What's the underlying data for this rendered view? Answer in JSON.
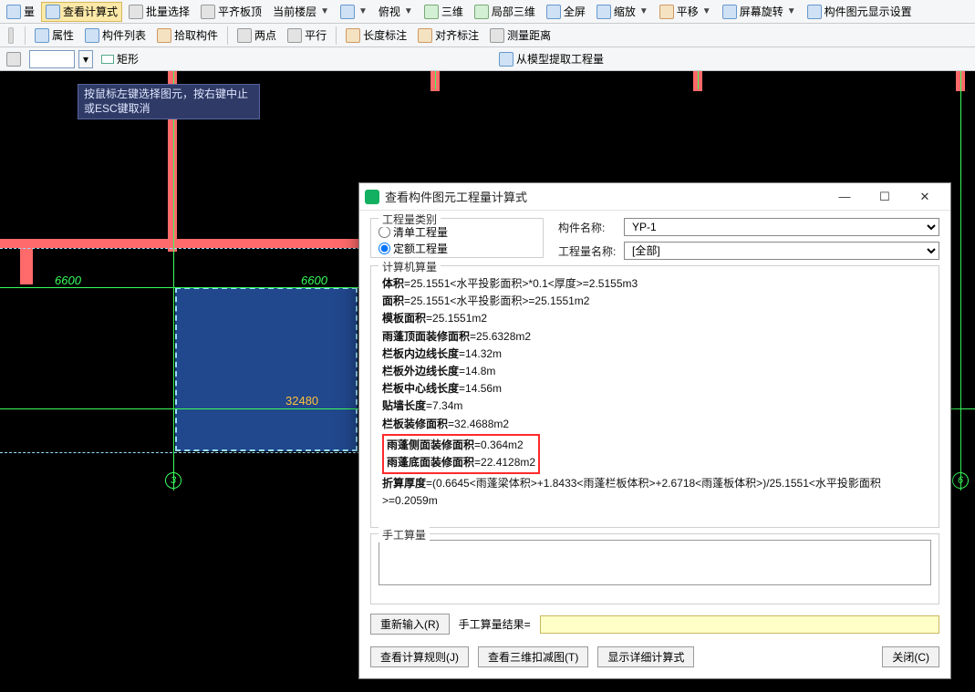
{
  "toolbar1": {
    "items": [
      {
        "label": "量",
        "icon": "ico-blue",
        "name": "btn-liang"
      },
      {
        "label": "查看计算式",
        "icon": "ico-blue",
        "name": "btn-view-calc",
        "selected": true
      },
      {
        "label": "批量选择",
        "icon": "ico-gray",
        "name": "btn-batch-select"
      },
      {
        "label": "平齐板顶",
        "icon": "ico-gray",
        "name": "btn-align-slab"
      },
      {
        "label": "当前楼层",
        "dropdown": true,
        "name": "sel-floor"
      },
      {
        "label": "",
        "icon": "ico-blue",
        "name": "btn-cube",
        "dropdown": true
      },
      {
        "label": "俯视",
        "dropdown": true,
        "name": "btn-top-view"
      },
      {
        "label": "三维",
        "icon": "ico-green",
        "name": "btn-3d"
      },
      {
        "label": "局部三维",
        "icon": "ico-green",
        "name": "btn-local-3d"
      },
      {
        "label": "全屏",
        "icon": "ico-blue",
        "name": "btn-fullscreen"
      },
      {
        "label": "缩放",
        "dropdown": true,
        "icon": "ico-blue",
        "name": "btn-zoom"
      },
      {
        "label": "平移",
        "dropdown": true,
        "icon": "ico-orange",
        "name": "btn-pan"
      },
      {
        "label": "屏幕旋转",
        "dropdown": true,
        "icon": "ico-blue",
        "name": "btn-rotate"
      },
      {
        "label": "构件图元显示设置",
        "icon": "ico-blue",
        "name": "btn-display-settings"
      }
    ]
  },
  "toolbar2": {
    "items": [
      {
        "label": "属性",
        "icon": "ico-blue",
        "name": "btn-props"
      },
      {
        "label": "构件列表",
        "icon": "ico-blue",
        "name": "btn-element-list"
      },
      {
        "label": "拾取构件",
        "icon": "ico-orange",
        "name": "btn-pick"
      },
      {
        "label": "两点",
        "icon": "ico-gray",
        "name": "btn-twopoint"
      },
      {
        "label": "平行",
        "icon": "ico-gray",
        "name": "btn-parallel"
      },
      {
        "label": "长度标注",
        "icon": "ico-orange",
        "name": "btn-dim-len"
      },
      {
        "label": "对齐标注",
        "icon": "ico-orange",
        "name": "btn-dim-align"
      },
      {
        "label": "测量距离",
        "icon": "ico-gray",
        "name": "btn-measure"
      }
    ]
  },
  "toolbar3": {
    "shape_label": "矩形",
    "extract_label": "从模型提取工程量"
  },
  "tooltip_text": "按鼠标左键选择图元，按右键中止或ESC键取消",
  "dims": {
    "d1": "6600",
    "d2": "6600",
    "center": "32480",
    "axis3": "3",
    "axis6": "6"
  },
  "dialog": {
    "title": "查看构件图元工程量计算式",
    "grp_type": "工程量类别",
    "radio_list": "清单工程量",
    "radio_quota": "定额工程量",
    "lbl_elem": "构件名称:",
    "lbl_proj": "工程量名称:",
    "sel_elem": "YP-1",
    "sel_proj": "[全部]",
    "grp_calc": "计算机算量",
    "calc_lines": [
      {
        "k": "体积",
        "v": "=25.1551<水平投影面积>*0.1<厚度>=2.5155m3"
      },
      {
        "k": "面积",
        "v": "=25.1551<水平投影面积>=25.1551m2"
      },
      {
        "k": "模板面积",
        "v": "=25.1551m2"
      },
      {
        "k": "雨蓬顶面装修面积",
        "v": "=25.6328m2"
      },
      {
        "k": "栏板内边线长度",
        "v": "=14.32m"
      },
      {
        "k": "栏板外边线长度",
        "v": "=14.8m"
      },
      {
        "k": "栏板中心线长度",
        "v": "=14.56m"
      },
      {
        "k": "贴墙长度",
        "v": "=7.34m"
      },
      {
        "k": "栏板装修面积",
        "v": "=32.4688m2"
      }
    ],
    "hl_line1_k": "雨蓬侧面装修面积",
    "hl_line1_v": "=0.364m2",
    "hl_line2_k": "雨蓬底面装修面积",
    "hl_line2_v": "=22.4128m2",
    "calc_tail_k": "折算厚度",
    "calc_tail_v": "=(0.6645<雨蓬梁体积>+1.8433<雨蓬栏板体积>+2.6718<雨蓬板体积>)/25.1551<水平投影面积>=0.2059m",
    "grp_manual": "手工算量",
    "btn_reinput": "重新输入(R)",
    "lbl_result": "手工算量结果=",
    "btn_rules": "查看计算规则(J)",
    "btn_3dcut": "查看三维扣减图(T)",
    "btn_detail": "显示详细计算式",
    "btn_close": "关闭(C)"
  }
}
